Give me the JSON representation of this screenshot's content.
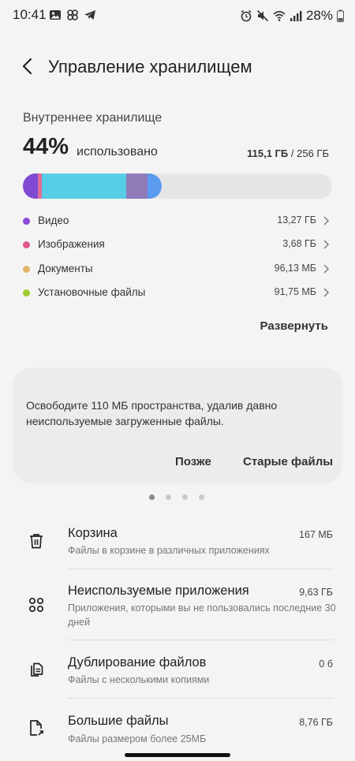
{
  "status_bar": {
    "time": "10:41",
    "battery": "28%",
    "left_icons": [
      "gallery-icon",
      "pinwheel-icon",
      "telegram-icon"
    ],
    "right_icons": [
      "alarm-icon",
      "mute-icon",
      "wifi-icon",
      "signal-icon",
      "battery-icon"
    ]
  },
  "header": {
    "title": "Управление хранилищем"
  },
  "storage": {
    "section_title": "Внутреннее хранилище",
    "percent": "44%",
    "used_label": "использовано",
    "used_amount": "115,1 ГБ",
    "separator": "/",
    "total_amount": "256 ГБ",
    "usage_fraction": 0.44,
    "bar_colors": [
      "#7f4ad1",
      "#e06c97",
      "#58cde6",
      "#8e7bb8",
      "#5a9bf0",
      "#e6e6e6"
    ],
    "categories": [
      {
        "label": "Видео",
        "value": "13,27 ГБ",
        "color": "#8a48d4"
      },
      {
        "label": "Изображения",
        "value": "3,68 ГБ",
        "color": "#e0578c"
      },
      {
        "label": "Документы",
        "value": "96,13 МБ",
        "color": "#e3b56a"
      },
      {
        "label": "Установочные файлы",
        "value": "91,75 МБ",
        "color": "#9ccc2e"
      }
    ],
    "expand_label": "Развернуть"
  },
  "suggestion": {
    "message": "Освободите 110 МБ пространства, удалив давно неиспользуемые загруженные файлы.",
    "later_label": "Позже",
    "old_files_label": "Старые файлы",
    "page_count": 4,
    "active_page": 0
  },
  "items": [
    {
      "name": "Корзина",
      "desc": "Файлы в корзине в различных приложениях",
      "size": "167 МБ",
      "icon": "trash-icon"
    },
    {
      "name": "Неиспользуемые приложения",
      "desc": "Приложения, которыми вы не пользовались последние 30 дней",
      "size": "9,63 ГБ",
      "icon": "apps-icon"
    },
    {
      "name": "Дублирование файлов",
      "desc": "Файлы с несколькими копиями",
      "size": "0 б",
      "icon": "duplicate-files-icon"
    },
    {
      "name": "Большие файлы",
      "desc": "Файлы размером более 25МБ",
      "size": "8,76 ГБ",
      "icon": "large-file-icon"
    }
  ]
}
